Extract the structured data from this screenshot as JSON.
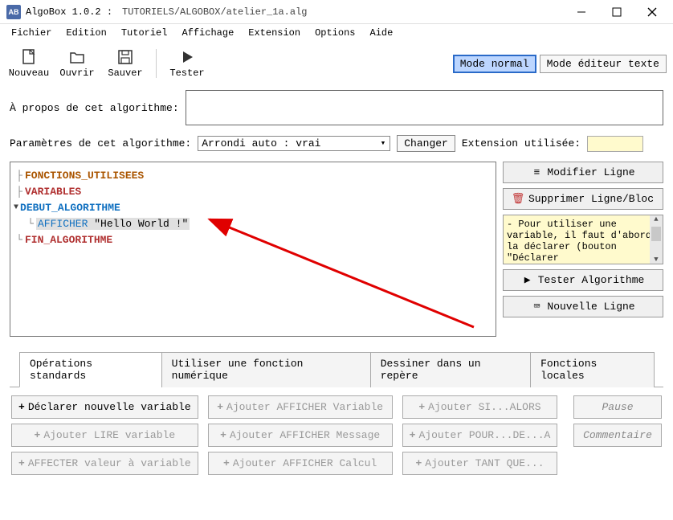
{
  "title": {
    "app": "AlgoBox 1.0.2 :",
    "path": "TUTORIELS/ALGOBOX/atelier_1a.alg"
  },
  "menu": {
    "fichier": "Fichier",
    "edition": "Edition",
    "tutoriel": "Tutoriel",
    "affichage": "Affichage",
    "extension": "Extension",
    "options": "Options",
    "aide": "Aide"
  },
  "toolbar": {
    "nouveau": "Nouveau",
    "ouvrir": "Ouvrir",
    "sauver": "Sauver",
    "tester": "Tester",
    "mode_normal": "Mode normal",
    "mode_editeur": "Mode éditeur texte"
  },
  "about_label": "À propos de cet algorithme:",
  "params_label": "Paramètres de cet algorithme:",
  "params_value": "Arrondi auto : vrai",
  "changer": "Changer",
  "ext_label": "Extension utilisée:",
  "code": {
    "fonctions": "FONCTIONS_UTILISEES",
    "variables": "VARIABLES",
    "debut": "DEBUT_ALGORITHME",
    "afficher": "AFFICHER",
    "afficher_arg": "\"Hello World !\"",
    "fin": "FIN_ALGORITHME"
  },
  "side": {
    "modifier": "Modifier Ligne",
    "supprimer": "Supprimer Ligne/Bloc",
    "help": "- Pour utiliser une variable, il faut d'abord la déclarer (bouton \"Déclarer",
    "tester": "Tester Algorithme",
    "nouvelle": "Nouvelle Ligne"
  },
  "tabs": {
    "std": "Opérations standards",
    "fn": "Utiliser une fonction numérique",
    "draw": "Dessiner dans un repère",
    "local": "Fonctions locales"
  },
  "ops": {
    "declarer": "Déclarer nouvelle variable",
    "lire": "Ajouter LIRE variable",
    "affecter": "AFFECTER valeur à variable",
    "aff_var": "Ajouter AFFICHER Variable",
    "aff_msg": "Ajouter AFFICHER Message",
    "aff_calc": "Ajouter AFFICHER Calcul",
    "si": "Ajouter SI...ALORS",
    "pour": "Ajouter POUR...DE...A",
    "tant": "Ajouter TANT QUE...",
    "pause": "Pause",
    "comment": "Commentaire"
  }
}
